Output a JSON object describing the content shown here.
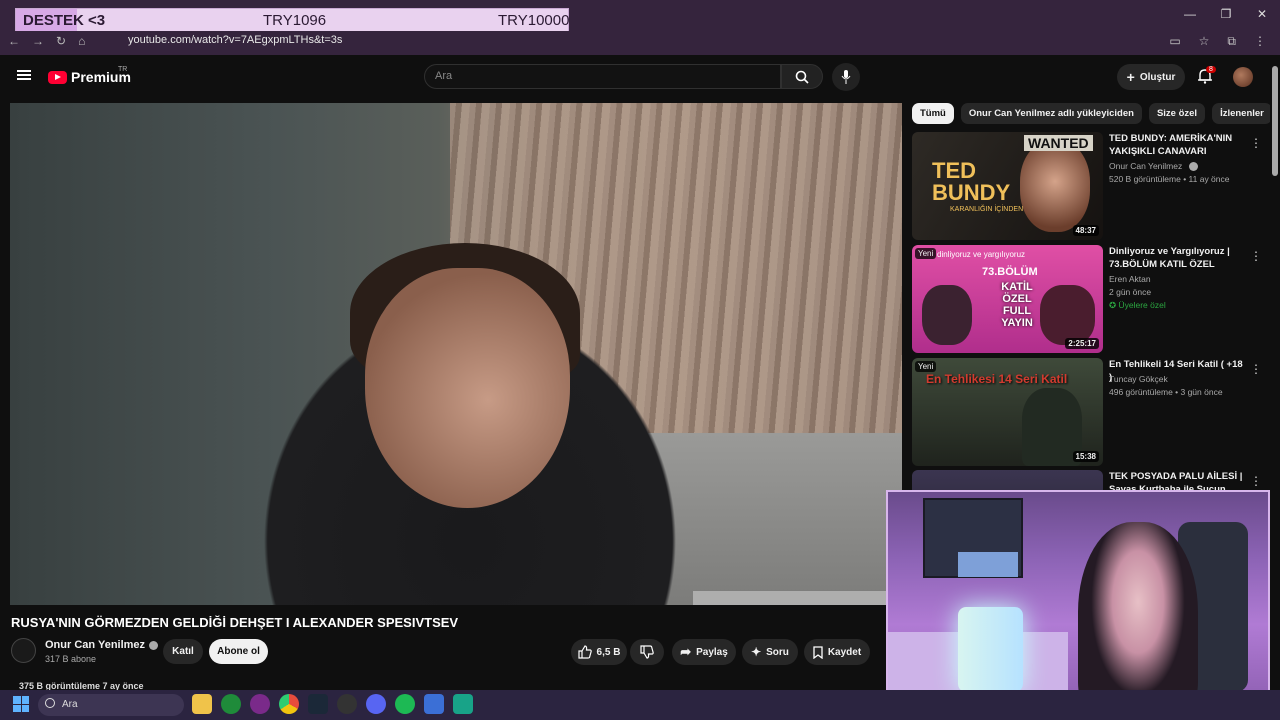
{
  "overlay": {
    "label": "DESTEK <3",
    "current": "TRY1096",
    "goal": "TRY10000",
    "progress": 0.11
  },
  "browser": {
    "url": "youtube.com/watch?v=7AEgxpmLTHs&t=3s"
  },
  "header": {
    "logo": "Premium",
    "country": "TR",
    "search_placeholder": "Ara",
    "create_label": "Oluştur",
    "notif_count": "8"
  },
  "video": {
    "title": "RUSYA'NIN GÖRMEZDEN GELDİĞİ DEHŞET I ALEXANDER SPESIVTSEV",
    "channel": "Onur Can Yenilmez",
    "subscribers": "317 B abone",
    "join_label": "Katıl",
    "subscribe_label": "Abone ol",
    "likes": "6,5 B",
    "share_label": "Paylaş",
    "ask_label": "Soru",
    "save_label": "Kaydet",
    "views": "375 B görüntüleme  7 ay önce"
  },
  "chips": [
    "Tümü",
    "Onur Can Yenilmez adlı yükleyiciden",
    "Size özel",
    "İzlenenler"
  ],
  "recommendations": [
    {
      "title": "TED BUNDY: AMERİKA'NIN YAKIŞIKLI CANAVARI",
      "channel": "Onur Can Yenilmez",
      "meta": "520 B görüntüleme • 11 ay önce",
      "duration": "48:37",
      "thumb_text_1": "TED",
      "thumb_text_2": "BUNDY",
      "thumb_text_3": "KARANLIĞIN İÇİNDEN",
      "thumb_text_4": "WANTED"
    },
    {
      "title": "Dinliyoruz ve Yargılıyoruz | 73.BÖLÜM KATIL ÖZEL",
      "channel": "Eren Aktan",
      "meta": "2 gün önce",
      "badge": "Üyelere özel",
      "duration": "2:25:17",
      "new": "Yeni",
      "thumb_text_1": "dinliyoruz ve yargılıyoruz",
      "thumb_text_2": "73.BÖLÜM",
      "thumb_text_3": "KATİL ÖZEL FULL YAYIN"
    },
    {
      "title": "En Tehlikeli 14 Seri Katil ( +18 )",
      "channel": "Tuncay Gökçek",
      "meta": "496 görüntüleme • 3 gün önce",
      "duration": "15:38",
      "new": "Yeni",
      "thumb_text_1": "En Tehlikesi",
      "thumb_text_2": "14 Seri Katil"
    },
    {
      "title": "TEK POSYADA PALU AİLESİ | Savaş Kurtbaba ile Suçun ...",
      "channel": "",
      "meta": ""
    }
  ],
  "taskbar": {
    "search_placeholder": "Ara"
  }
}
